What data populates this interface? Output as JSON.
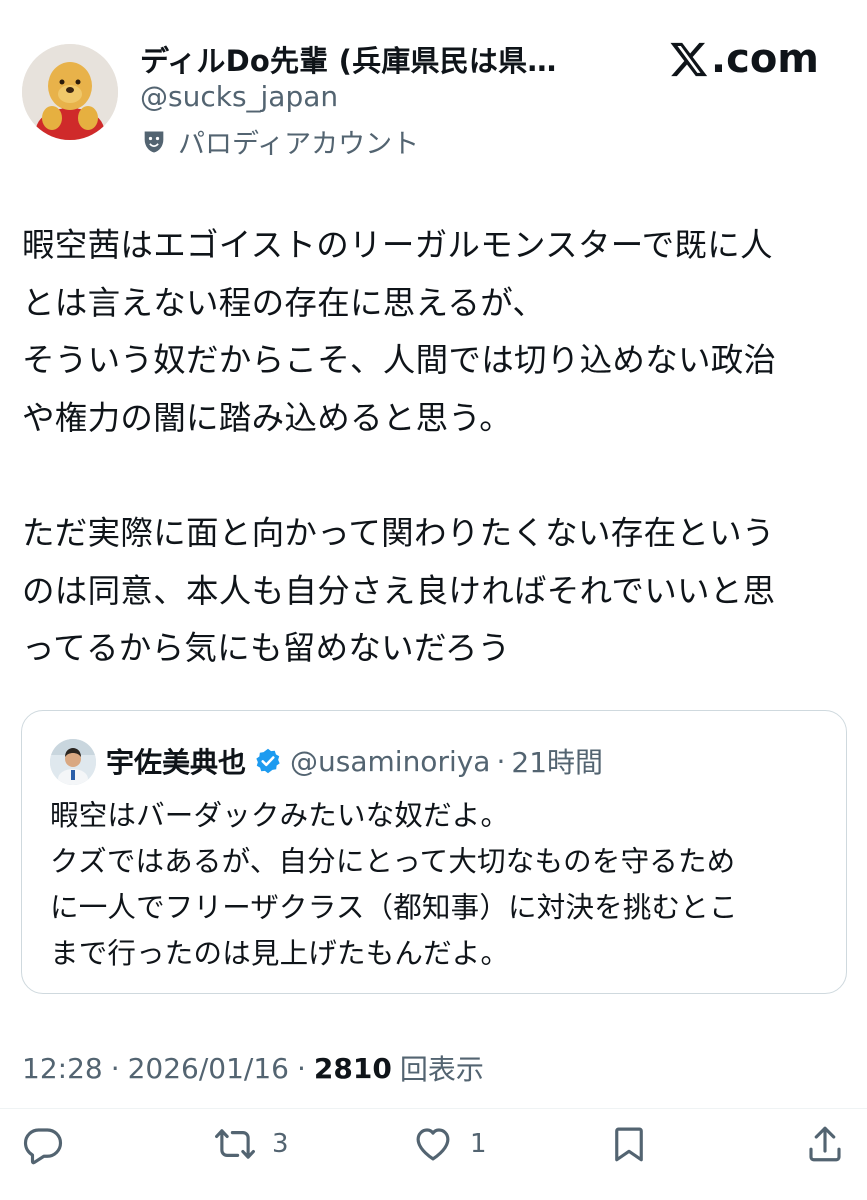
{
  "header": {
    "display_name": "ディルDo先輩 (兵庫県民は県…",
    "handle": "@sucks_japan",
    "parody_label": "パロディアカウント",
    "logo_text": ".com",
    "avatar_icon": "winnie-pooh-face-avatar",
    "parody_icon": "theater-mask-icon"
  },
  "tweet": {
    "text": "暇空茜はエゴイストのリーガルモンスターで既に人\nとは言えない程の存在に思えるが、\nそういう奴だからこそ、人間では切り込めない政治\nや権力の闇に踏み込めると思う。\n\nただ実際に面と向かって関わりたくない存在という\nのは同意、本人も自分さえ良ければそれでいいと思\nってるから気にも留めないだろう"
  },
  "quote": {
    "name": "宇佐美典也",
    "handle": "@usaminoriya",
    "dot": "·",
    "time": "21時間",
    "text": "暇空はバーダックみたいな奴だよ。\nクズではあるが、自分にとって大切なものを守るため\nに一人でフリーザクラス（都知事）に対決を挑むとこ\nまで行ったのは見上げたもんだよ。",
    "verified_color": "#1d9bf0"
  },
  "meta": {
    "time": "12:28",
    "sep1": "·",
    "date": "2026/01/16",
    "sep2": "·",
    "views_count": "2810",
    "views_label": "回表示"
  },
  "actions": {
    "reply_icon": "reply-bubble-icon",
    "retweet_icon": "retweet-icon",
    "retweet_count": "3",
    "like_icon": "heart-icon",
    "like_count": "1",
    "bookmark_icon": "bookmark-icon",
    "share_icon": "share-icon"
  },
  "colors": {
    "text_primary": "#0f1419",
    "text_secondary": "#536471",
    "border": "#cfd9de",
    "verified": "#1d9bf0"
  }
}
